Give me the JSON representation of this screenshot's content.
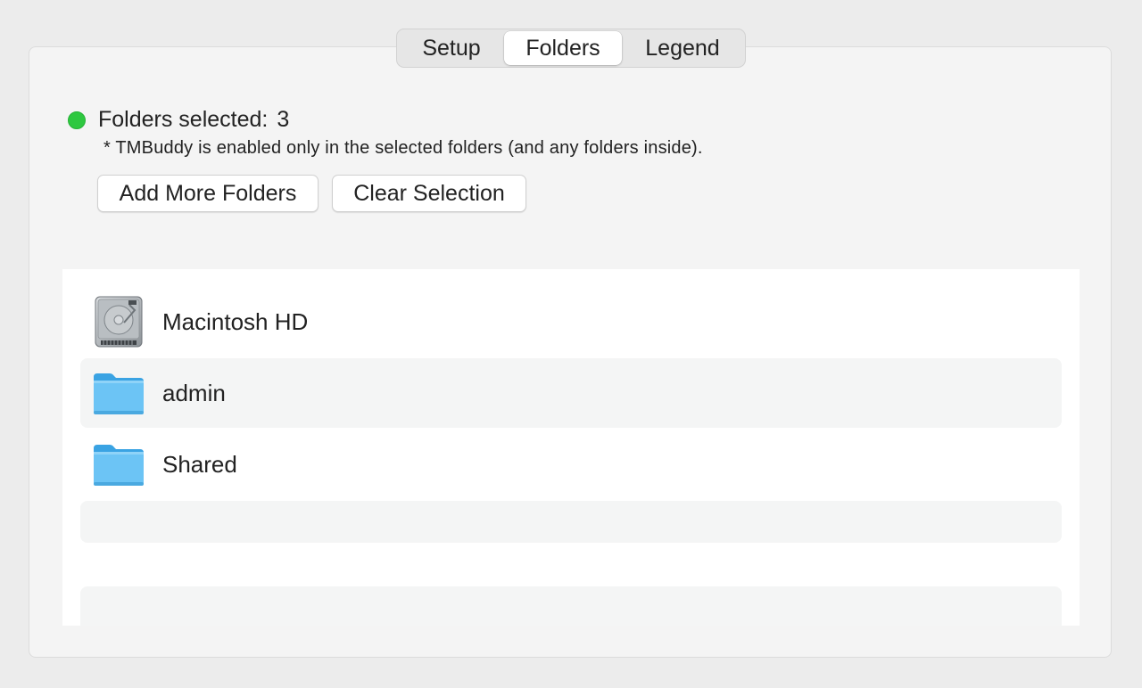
{
  "tabs": [
    {
      "label": "Setup"
    },
    {
      "label": "Folders",
      "selected": true
    },
    {
      "label": "Legend"
    }
  ],
  "status": {
    "indicator_color": "#2ec840",
    "label": "Folders selected:",
    "count": "3",
    "note": "* TMBuddy is enabled only in the selected folders (and any folders inside)."
  },
  "buttons": {
    "add_label": "Add More Folders",
    "clear_label": "Clear Selection"
  },
  "folders": [
    {
      "name": "Macintosh HD",
      "icon": "hard-drive-icon"
    },
    {
      "name": "admin",
      "icon": "folder-icon"
    },
    {
      "name": "Shared",
      "icon": "folder-icon"
    }
  ],
  "colors": {
    "folder_blue": "#6cc4f5",
    "accent_green": "#2ec840"
  }
}
